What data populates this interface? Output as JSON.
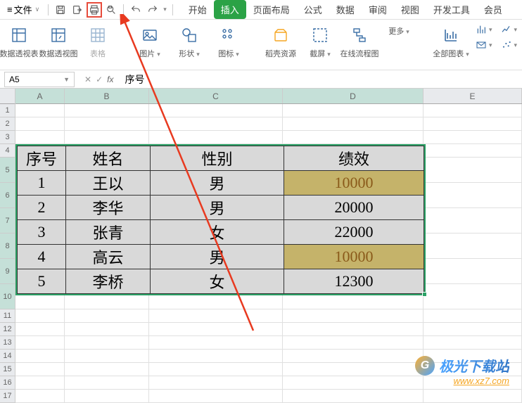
{
  "toolbar": {
    "menu_label": "文件",
    "menu_dd": "∨"
  },
  "tabs": {
    "start": "开始",
    "insert": "插入",
    "layout": "页面布局",
    "formula": "公式",
    "data": "数据",
    "review": "审阅",
    "view": "视图",
    "dev": "开发工具",
    "member": "会员"
  },
  "ribbon": {
    "pivot_table": "数据透视表",
    "pivot_chart": "数据透视图",
    "table": "表格",
    "picture": "图片",
    "shape": "形状",
    "icon": "图标",
    "docer": "稻壳资源",
    "screenshot": "截屏",
    "flowchart": "在线流程图",
    "more": "更多",
    "all_charts": "全部图表"
  },
  "formula_bar": {
    "name_box": "A5",
    "fx": "fx",
    "value": "序号"
  },
  "columns": [
    "A",
    "B",
    "C",
    "D",
    "E"
  ],
  "rows_small": [
    "1",
    "2",
    "3",
    "4"
  ],
  "rows_data": [
    "5",
    "6",
    "7",
    "8",
    "9",
    "10"
  ],
  "rows_after": [
    "11",
    "12",
    "13",
    "14",
    "15",
    "16",
    "17"
  ],
  "chart_data": {
    "type": "table",
    "headers": [
      "序号",
      "姓名",
      "性别",
      "绩效"
    ],
    "rows": [
      {
        "no": "1",
        "name": "王以",
        "gender": "男",
        "score": "10000",
        "hl": true
      },
      {
        "no": "2",
        "name": "李华",
        "gender": "男",
        "score": "20000",
        "hl": false
      },
      {
        "no": "3",
        "name": "张青",
        "gender": "女",
        "score": "22000",
        "hl": false
      },
      {
        "no": "4",
        "name": "高云",
        "gender": "男",
        "score": "10000",
        "hl": true
      },
      {
        "no": "5",
        "name": "李桥",
        "gender": "女",
        "score": "12300",
        "hl": false
      }
    ]
  },
  "watermark": {
    "text": "极光下载站",
    "url": "www.xz7.com"
  }
}
